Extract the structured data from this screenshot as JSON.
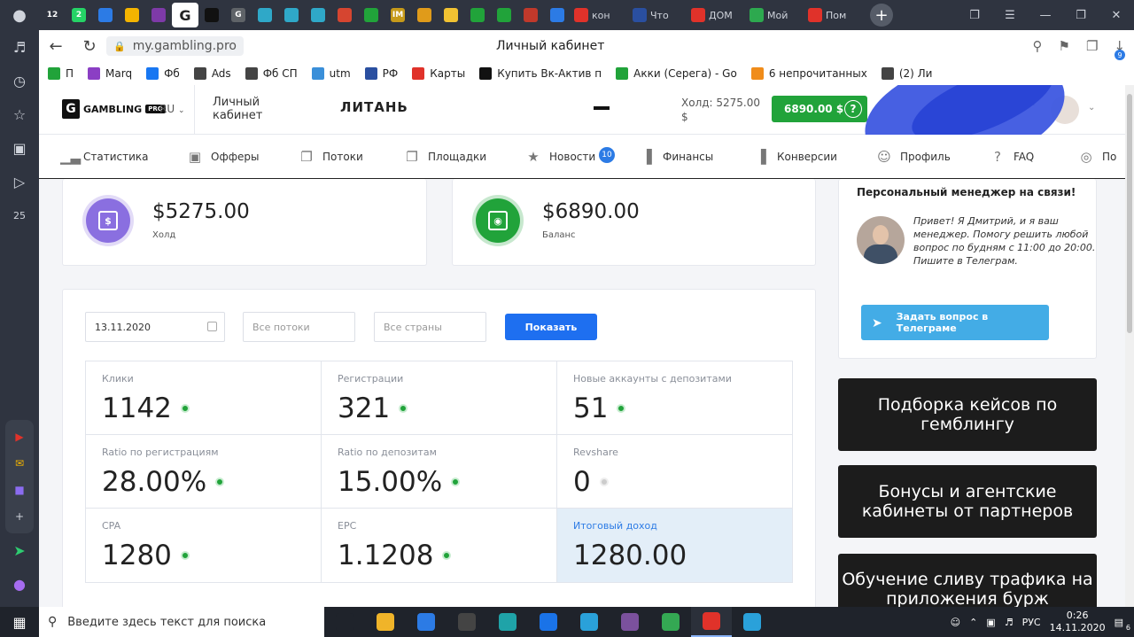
{
  "browser": {
    "tabs": [
      {
        "label": "12",
        "icon": "twelve-icon",
        "color": "#2f3440"
      },
      {
        "label": "2",
        "icon": "whatsapp-icon",
        "color": "#25d366"
      },
      {
        "label": "",
        "icon": "mail-icon",
        "color": "#2c7be5"
      },
      {
        "label": "",
        "icon": "gmail-icon",
        "color": "#f4b400"
      },
      {
        "label": "",
        "icon": "puzzle-icon",
        "color": "#7e3aa8"
      },
      {
        "label": "G",
        "icon": "google-icon",
        "color": "#ffffff",
        "active": true
      },
      {
        "label": "",
        "icon": "plus-box-icon",
        "color": "#111111"
      },
      {
        "label": "G",
        "icon": "google-icon",
        "color": "#5f6368"
      },
      {
        "label": "",
        "icon": "planet-icon",
        "color": "#2fa8c8"
      },
      {
        "label": "",
        "icon": "planet-icon",
        "color": "#2fa8c8"
      },
      {
        "label": "",
        "icon": "planet-icon",
        "color": "#2fa8c8"
      },
      {
        "label": "",
        "icon": "cube-icon",
        "color": "#d64530"
      },
      {
        "label": "",
        "icon": "cross-green-icon",
        "color": "#21a33a"
      },
      {
        "label": "IM",
        "icon": "im-icon",
        "color": "#c69a1a"
      },
      {
        "label": "",
        "icon": "box-icon",
        "color": "#e09b1a"
      },
      {
        "label": "",
        "icon": "chat-icon",
        "color": "#f1c232"
      },
      {
        "label": "",
        "icon": "cross-green-icon",
        "color": "#21a33a"
      },
      {
        "label": "",
        "icon": "cross-green-icon",
        "color": "#21a33a"
      },
      {
        "label": "",
        "icon": "bottle-icon",
        "color": "#c0392b"
      },
      {
        "label": "",
        "icon": "pause-icon",
        "color": "#2c7be5"
      }
    ],
    "wide_tabs": [
      {
        "label": "кон",
        "icon": "yandex-icon",
        "color": "#e0322a"
      },
      {
        "label": "Что",
        "icon": "captain-icon",
        "color": "#2a4fa0"
      },
      {
        "label": "ДОМ",
        "icon": "youtube-icon",
        "color": "#e0322a"
      },
      {
        "label": "Мой",
        "icon": "drive-icon",
        "color": "#2da94f"
      },
      {
        "label": "Пом",
        "icon": "youtube-icon",
        "color": "#e0322a"
      }
    ],
    "url": "my.gambling.pro",
    "page_title": "Личный кабинет",
    "download_count": "9",
    "bookmarks": [
      {
        "label": "П",
        "color": "#21a33a"
      },
      {
        "label": "Marq",
        "color": "#8b3fc4"
      },
      {
        "label": "Фб",
        "color": "#1877f2"
      },
      {
        "label": "Ads",
        "color": "#444444"
      },
      {
        "label": "Фб СП",
        "color": "#444444"
      },
      {
        "label": "utm",
        "color": "#3a8fd9"
      },
      {
        "label": "РФ",
        "color": "#2a4fa0"
      },
      {
        "label": "Карты",
        "color": "#e0322a"
      },
      {
        "label": "Купить Вк-Актив п",
        "color": "#111111"
      },
      {
        "label": "Акки (Серега) - Go",
        "color": "#21a33a"
      },
      {
        "label": "6 непрочитанных",
        "color": "#f08c1a"
      },
      {
        "label": "(2) Ли",
        "color": "#444444"
      }
    ]
  },
  "site": {
    "logo_text": "GAMBLING",
    "logo_badge": "PRO",
    "lang": "RU",
    "cabinet": "Личный кабинет",
    "promo": "ЛИТАНЬ",
    "hold": "Холд: 5275.00 $",
    "balance_btn": "6890.00 $",
    "user_suffix": "ru",
    "nav": [
      {
        "label": "Статистика",
        "icon": "chart-icon"
      },
      {
        "label": "Офферы",
        "icon": "image-icon"
      },
      {
        "label": "Потоки",
        "icon": "copy-icon"
      },
      {
        "label": "Площадки",
        "icon": "copy-icon"
      },
      {
        "label": "Новости",
        "icon": "star-icon",
        "badge": "10"
      },
      {
        "label": "Финансы",
        "icon": "bars-icon"
      },
      {
        "label": "Конверсии",
        "icon": "bars-icon"
      },
      {
        "label": "Профиль",
        "icon": "user-icon"
      },
      {
        "label": "FAQ",
        "icon": "help-icon"
      },
      {
        "label": "По",
        "icon": "lifebuoy-icon"
      }
    ],
    "money": [
      {
        "amount": "$5275.00",
        "label": "Холд",
        "color": "#8a6fe0"
      },
      {
        "amount": "$6890.00",
        "label": "Баланс",
        "color": "#21a33a"
      }
    ],
    "filters": {
      "date": "13.11.2020",
      "streams_placeholder": "Все потоки",
      "countries_placeholder": "Все страны",
      "show_label": "Показать"
    },
    "stats": [
      {
        "title": "Клики",
        "value": "1142",
        "dot": "green"
      },
      {
        "title": "Регистрации",
        "value": "321",
        "dot": "green"
      },
      {
        "title": "Новые аккаунты с депозитами",
        "value": "51",
        "dot": "green"
      },
      {
        "title": "Ratio по регистрациям",
        "value": "28.00%",
        "dot": "green"
      },
      {
        "title": "Ratio по депозитам",
        "value": "15.00%",
        "dot": "green"
      },
      {
        "title": "Revshare",
        "value": "0",
        "dot": "gray"
      },
      {
        "title": "CPA",
        "value": "1280",
        "dot": "green"
      },
      {
        "title": "EPC",
        "value": "1.1208",
        "dot": "green"
      },
      {
        "title": "Итоговый доход",
        "value": "1280.00",
        "dot": "none"
      }
    ],
    "manager": {
      "title": "Персональный менеджер на связи!",
      "message": "Привет! Я Дмитрий, и я ваш менеджер. Помогу решить любой вопрос по будням с 11:00 до 20:00. Пишите в Телеграм.",
      "tg_button": "Задать вопрос в Телеграме"
    },
    "banners": [
      "Подборка кейсов по гемблингу",
      "Бонусы и агентские кабинеты от партнеров",
      "Обучение сливу трафика на приложения бурж"
    ]
  },
  "taskbar": {
    "search_placeholder": "Введите здесь текст для поиска",
    "apps": [
      {
        "icon": "task-view-icon",
        "color": "#1f232b"
      },
      {
        "icon": "folder-icon",
        "color": "#f0b429"
      },
      {
        "icon": "store-icon",
        "color": "#2c7be5"
      },
      {
        "icon": "calculator-icon",
        "color": "#444444"
      },
      {
        "icon": "edge-icon",
        "color": "#1fa3a8"
      },
      {
        "icon": "teamviewer-icon",
        "color": "#1a73e8"
      },
      {
        "icon": "telegram-icon",
        "color": "#2aa1da"
      },
      {
        "icon": "viber-icon",
        "color": "#7b519d"
      },
      {
        "icon": "chrome-icon",
        "color": "#34a853"
      },
      {
        "icon": "yandex-browser-icon",
        "color": "#e0322a",
        "active": true
      },
      {
        "icon": "telegram-icon",
        "color": "#2aa1da"
      }
    ],
    "lang": "РУС",
    "time": "0:26",
    "date": "14.11.2020",
    "notifications": "6"
  }
}
